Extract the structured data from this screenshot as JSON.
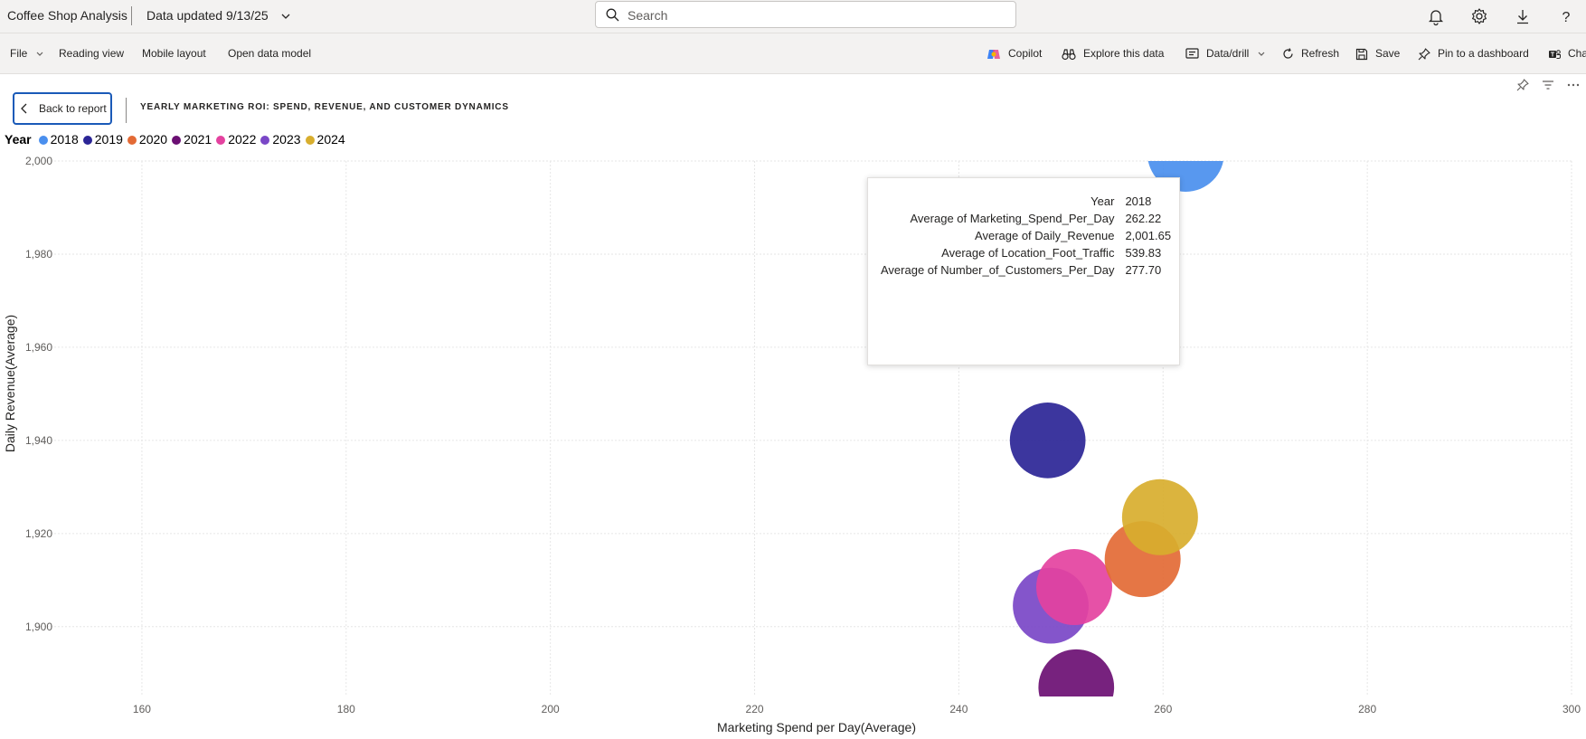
{
  "app": {
    "title": "Coffee Shop Analysis",
    "data_updated": "Data updated 9/13/25",
    "search_placeholder": "Search"
  },
  "commands": {
    "file": "File",
    "reading_view": "Reading view",
    "mobile_layout": "Mobile layout",
    "open_data_model": "Open data model",
    "copilot": "Copilot",
    "explore": "Explore this data",
    "data_drill": "Data/drill",
    "refresh": "Refresh",
    "save": "Save",
    "pin": "Pin to a dashboard",
    "chat": "Chat"
  },
  "report": {
    "back_label": "Back to report",
    "visual_title": "YEARLY MARKETING ROI: SPEND, REVENUE, AND CUSTOMER DYNAMICS"
  },
  "legend": {
    "title": "Year",
    "items": [
      {
        "label": "2018",
        "color": "#4a8fee"
      },
      {
        "label": "2019",
        "color": "#2b2596"
      },
      {
        "label": "2020",
        "color": "#e36a35"
      },
      {
        "label": "2021",
        "color": "#6b0f73"
      },
      {
        "label": "2022",
        "color": "#e4429f"
      },
      {
        "label": "2023",
        "color": "#7a47c7"
      },
      {
        "label": "2024",
        "color": "#d8ae2e"
      }
    ]
  },
  "chart_data": {
    "type": "scatter",
    "title": "YEARLY MARKETING ROI: SPEND, REVENUE, AND CUSTOMER DYNAMICS",
    "xlabel": "Marketing Spend per Day(Average)",
    "ylabel": "Daily Revenue(Average)",
    "xlim": [
      150,
      300
    ],
    "ylim": [
      1885,
      2000
    ],
    "x_ticks": [
      160,
      180,
      200,
      220,
      240,
      260,
      280,
      300
    ],
    "y_ticks": [
      1900,
      1920,
      1940,
      1960,
      1980,
      2000
    ],
    "x_tick_labels": [
      "160",
      "180",
      "200",
      "220",
      "240",
      "260",
      "280",
      "300"
    ],
    "y_tick_labels": [
      "1,900",
      "1,920",
      "1,940",
      "1,960",
      "1,980",
      "2,000"
    ],
    "grid": true,
    "legend_position": "top-left",
    "series": [
      {
        "name": "2018",
        "color": "#4a8fee",
        "x": 262.22,
        "y": 2001.65,
        "size": 277.7
      },
      {
        "name": "2019",
        "color": "#2b2596",
        "x": 248.7,
        "y": 1940,
        "size": 270
      },
      {
        "name": "2020",
        "color": "#e36a35",
        "x": 258,
        "y": 1914.5,
        "size": 272
      },
      {
        "name": "2021",
        "color": "#6b0f73",
        "x": 251.5,
        "y": 1887,
        "size": 270
      },
      {
        "name": "2022",
        "color": "#e4429f",
        "x": 251.3,
        "y": 1908.5,
        "size": 272
      },
      {
        "name": "2023",
        "color": "#7a47c7",
        "x": 249,
        "y": 1904.5,
        "size": 271
      },
      {
        "name": "2024",
        "color": "#d8ae2e",
        "x": 259.7,
        "y": 1923.5,
        "size": 272
      }
    ]
  },
  "tooltip": {
    "rows": [
      {
        "key": "Year",
        "value": "2018"
      },
      {
        "key": "Average of Marketing_Spend_Per_Day",
        "value": "262.22"
      },
      {
        "key": "Average of Daily_Revenue",
        "value": "2,001.65"
      },
      {
        "key": "Average of Location_Foot_Traffic",
        "value": "539.83"
      },
      {
        "key": "Average of Number_of_Customers_Per_Day",
        "value": "277.70"
      }
    ]
  }
}
